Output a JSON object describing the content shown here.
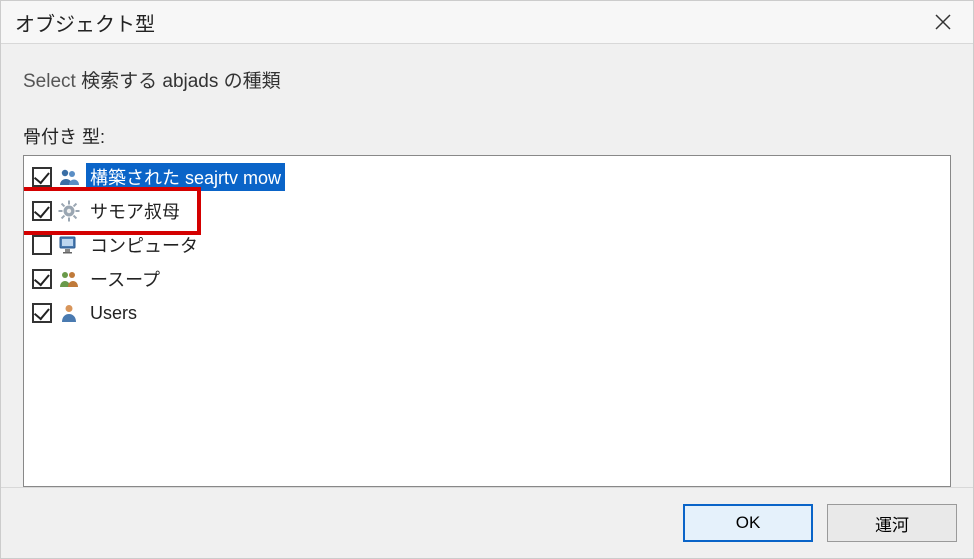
{
  "title": "オブジェクト型",
  "instruction_prefix": "Select ",
  "instruction_rest": "検索する abjads の種類",
  "list_label": "骨付き 型:",
  "items": [
    {
      "label": "構築された seajrtv mow",
      "checked": true,
      "selected": true,
      "icon": "people-group"
    },
    {
      "label": "サモア叔母",
      "checked": true,
      "selected": false,
      "icon": "gear"
    },
    {
      "label": "コンピュータ",
      "checked": false,
      "selected": false,
      "icon": "computer"
    },
    {
      "label": "ースープ",
      "checked": true,
      "selected": false,
      "icon": "people-pair"
    },
    {
      "label": "Users",
      "checked": true,
      "selected": false,
      "icon": "person"
    }
  ],
  "highlight_index": 1,
  "buttons": {
    "ok": "OK",
    "cancel": "運河"
  }
}
